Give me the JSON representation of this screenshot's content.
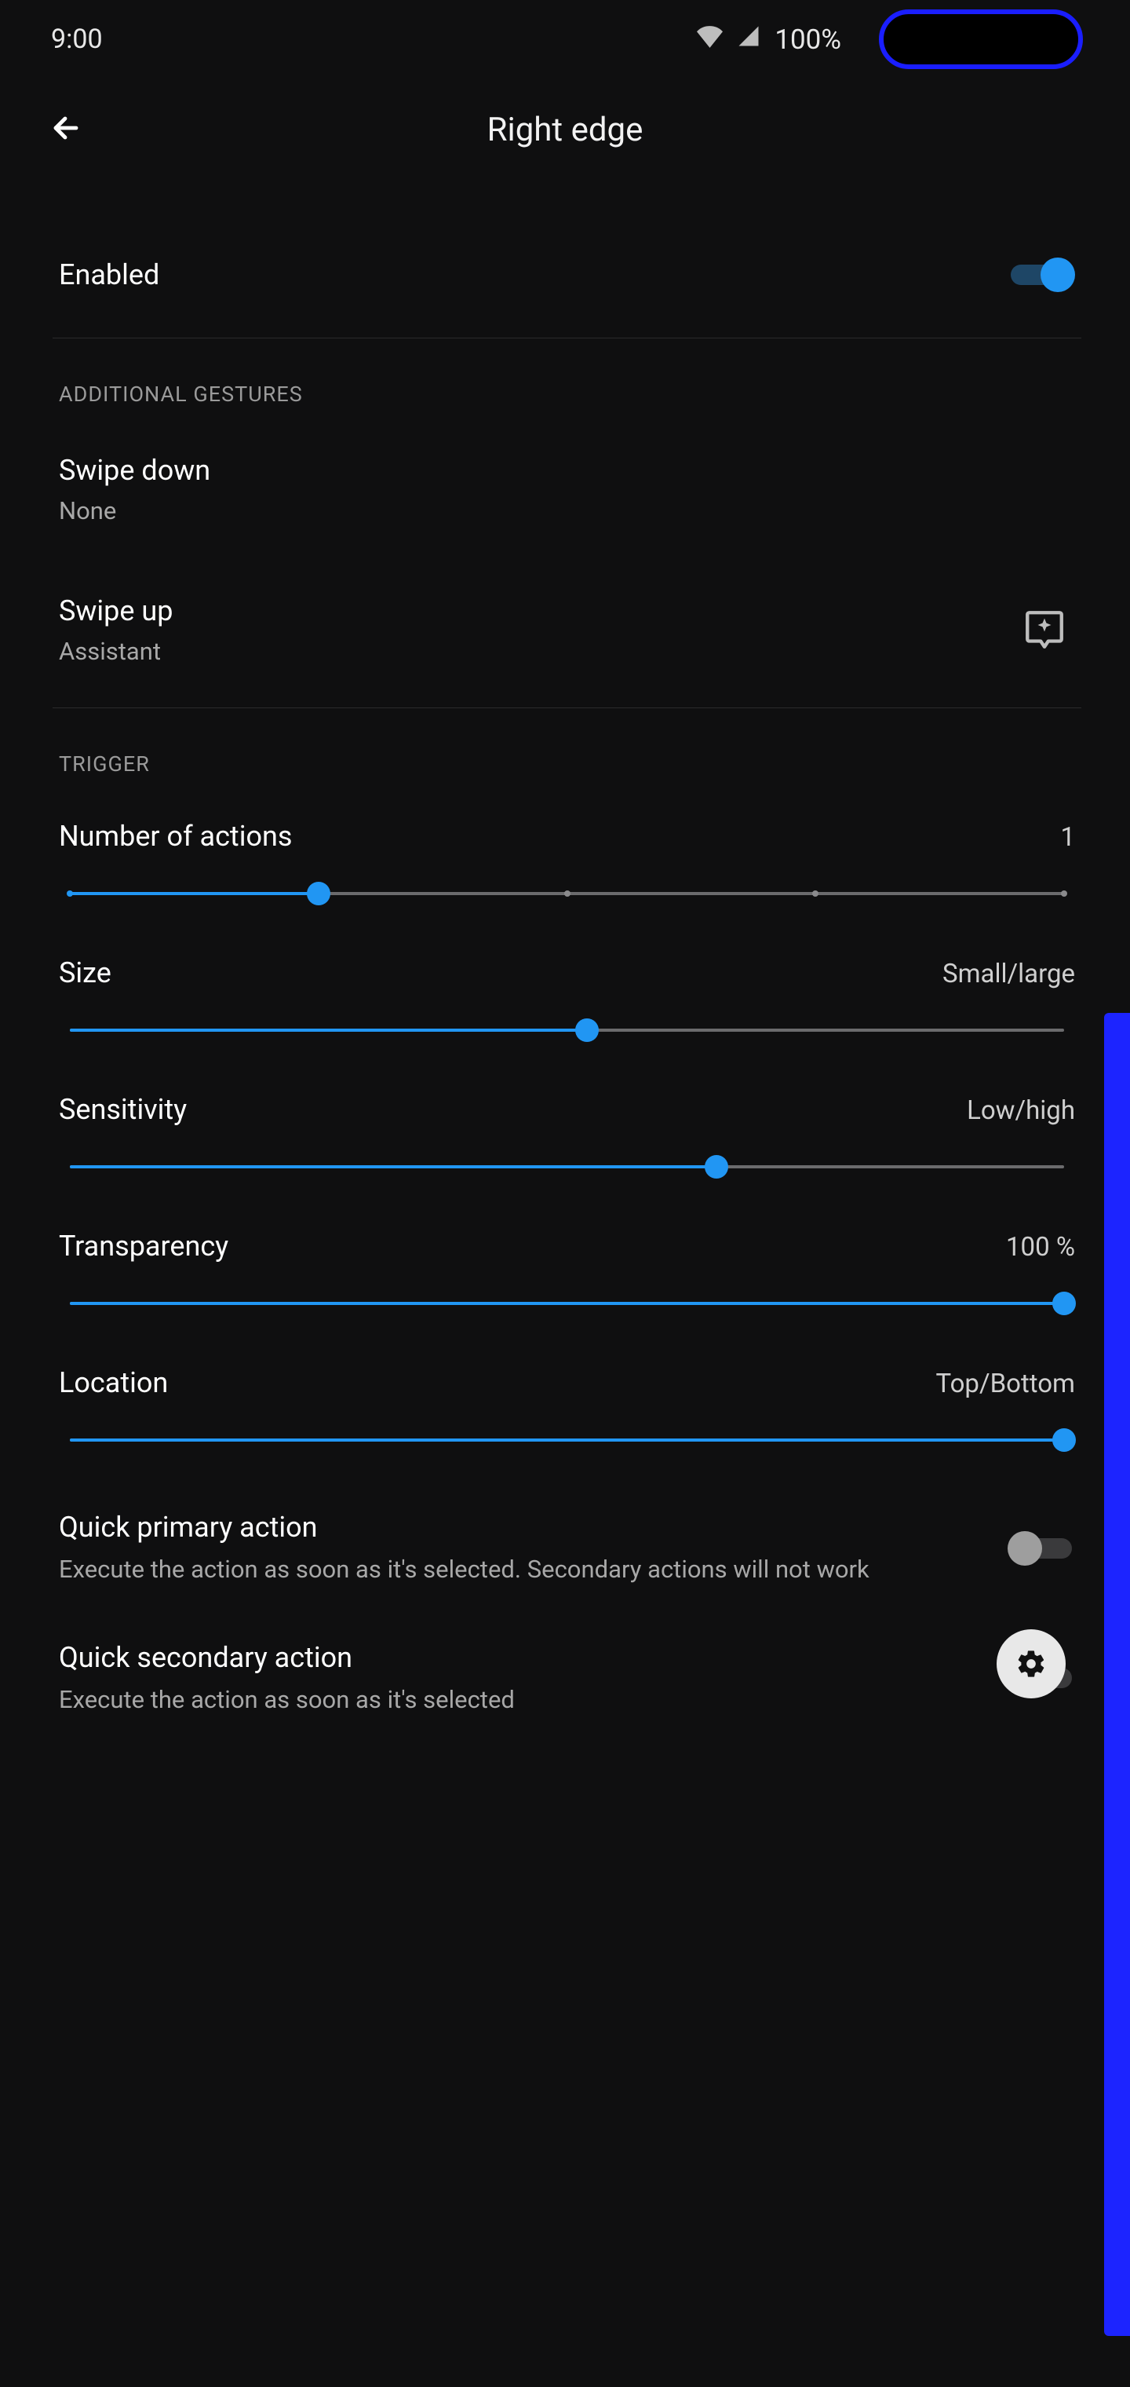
{
  "statusbar": {
    "time": "9:00",
    "battery": "100%"
  },
  "appbar": {
    "title": "Right edge"
  },
  "enabled": {
    "label": "Enabled",
    "on": true
  },
  "section_additional": "Additional gestures",
  "swipe_down": {
    "title": "Swipe down",
    "sub": "None"
  },
  "swipe_up": {
    "title": "Swipe up",
    "sub": "Assistant"
  },
  "section_trigger": "Trigger",
  "sliders": {
    "actions": {
      "title": "Number of actions",
      "value_label": "1",
      "percent": 25,
      "ticks": [
        0,
        25,
        50,
        75,
        100
      ]
    },
    "size": {
      "title": "Size",
      "value_label": "Small/large",
      "percent": 52
    },
    "sensitivity": {
      "title": "Sensitivity",
      "value_label": "Low/high",
      "percent": 65
    },
    "transparency": {
      "title": "Transparency",
      "value_label": "100 %",
      "percent": 100
    },
    "location": {
      "title": "Location",
      "value_label": "Top/Bottom",
      "percent": 100
    }
  },
  "quick_primary": {
    "title": "Quick primary action",
    "sub": "Execute the action as soon as it's selected. Secondary actions will not work",
    "on": false
  },
  "quick_secondary": {
    "title": "Quick secondary action",
    "sub": "Execute the action as soon as it's selected",
    "on": false
  }
}
